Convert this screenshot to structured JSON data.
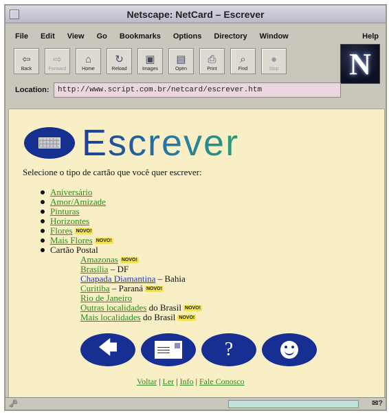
{
  "window": {
    "title": "Netscape: NetCard – Escrever"
  },
  "menu": [
    "File",
    "Edit",
    "View",
    "Go",
    "Bookmarks",
    "Options",
    "Directory",
    "Window"
  ],
  "menu_help": "Help",
  "toolbar": [
    {
      "label": "Back",
      "icon": "⇦",
      "name": "back"
    },
    {
      "label": "Forward",
      "icon": "⇨",
      "name": "forward",
      "disabled": true
    },
    {
      "label": "Home",
      "icon": "⌂",
      "name": "home"
    },
    {
      "label": "Reload",
      "icon": "↻",
      "name": "reload"
    },
    {
      "label": "Images",
      "icon": "▣",
      "name": "images"
    },
    {
      "label": "Open",
      "icon": "▤",
      "name": "open"
    },
    {
      "label": "Print",
      "icon": "⎙",
      "name": "print"
    },
    {
      "label": "Find",
      "icon": "⌕",
      "name": "find"
    },
    {
      "label": "Stop",
      "icon": "●",
      "name": "stop",
      "disabled": true
    }
  ],
  "logo_letter": "N",
  "location": {
    "label": "Location:",
    "url": "http://www.script.com.br/netcard/escrever.htm"
  },
  "page": {
    "heading": "Escrever",
    "intro": "Selecione o tipo de cartão que você quer escrever:",
    "badge": "NOVO!",
    "categories": [
      {
        "label": "Aniversário"
      },
      {
        "label": "Amor/Amizade"
      },
      {
        "label": "Pinturas"
      },
      {
        "label": "Horizontes"
      },
      {
        "label": "Flores",
        "new": true
      },
      {
        "label": "Mais Flores",
        "new": true
      },
      {
        "label": "Cartão Postal",
        "plain": true
      }
    ],
    "postal": [
      {
        "link": "Amazonas",
        "suffix": "",
        "new": true
      },
      {
        "link": "Brasília",
        "suffix": " – DF"
      },
      {
        "link": "Chapada Diamantina",
        "suffix": " – Bahia",
        "blue": true
      },
      {
        "link": "Curitiba",
        "suffix": " – Paraná",
        "new": true
      },
      {
        "link": "Rio de Janeiro",
        "suffix": ""
      },
      {
        "link": "Outras localidades",
        "suffix": " do Brasil",
        "new": true
      },
      {
        "link": "Mais localidades",
        "suffix": " do Brasil",
        "new": true
      }
    ],
    "footer": [
      "Voltar",
      "Ler",
      "Info",
      "Fale Conosco"
    ],
    "footer_sep": " | "
  },
  "colors": {
    "page_bg": "#f8efc6",
    "link": "#2e8a1e",
    "button_blue": "#172f93"
  }
}
